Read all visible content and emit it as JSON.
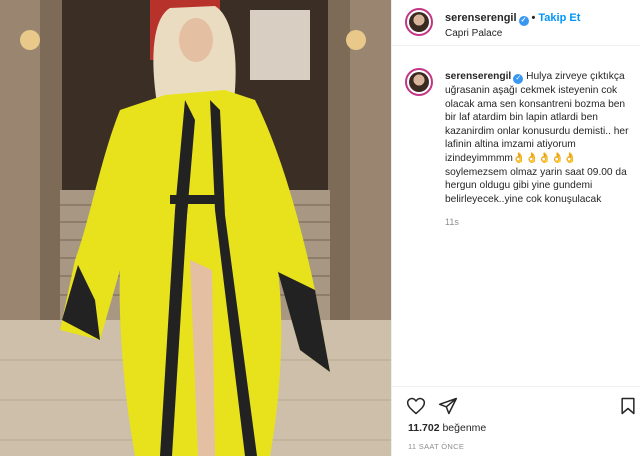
{
  "post": {
    "username": "serenserengil",
    "follow_label": "Takip Et",
    "location": "Capri Palace",
    "caption": "Hulya zirveye çıktıkça uğrasanin aşağı cekmek isteyenin cok olacak ama sen konsantreni bozma ben bir laf atardim bin lapin atlardi ben kazanirdim onlar konusurdu demisti.. her lafinin altina imzami atiyorum izindeyimmmm👌👌👌👌👌 soylemezsem olmaz yarin saat 09.00 da hergun oldugu gibi yine gundemi belirleyecek..yine cok konuşulacak",
    "comment_time": "11s",
    "likes_count": "11.702",
    "likes_label": "beğenme",
    "time_ago": "11 SAAT ÖNCE"
  },
  "icons": {
    "verified": "verified-badge-icon",
    "like": "heart-icon",
    "share": "paper-plane-icon",
    "save": "bookmark-icon"
  },
  "colors": {
    "accent": "#0095f6",
    "verified": "#3897f0",
    "robe": "#e8e21c",
    "robe_trim": "#222222"
  }
}
